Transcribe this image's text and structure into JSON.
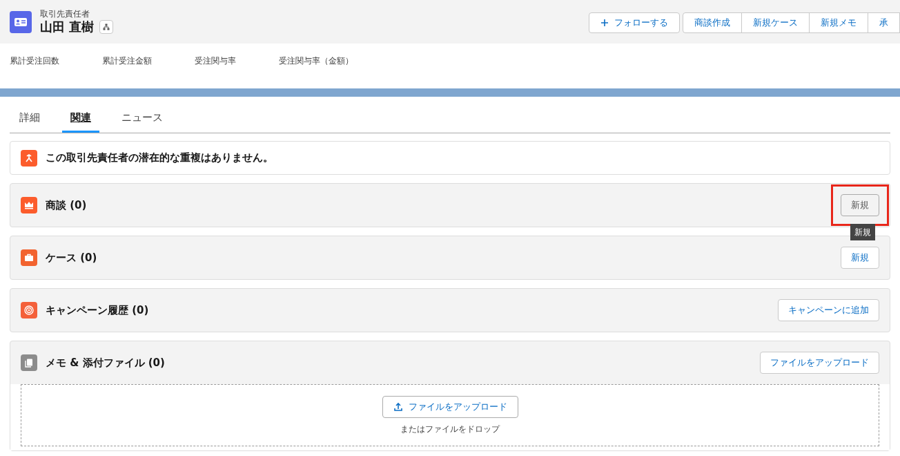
{
  "header": {
    "object_type": "取引先責任者",
    "name": "山田 直樹",
    "follow_button": "フォローする",
    "action_buttons": [
      "商談作成",
      "新規ケース",
      "新規メモ",
      "承"
    ]
  },
  "fields": [
    "累計受注回数",
    "累計受注金額",
    "受注関与率",
    "受注関与率（金額）"
  ],
  "tabs": [
    {
      "label": "詳細",
      "selected": false
    },
    {
      "label": "関連",
      "selected": true
    },
    {
      "label": "ニュース",
      "selected": false
    }
  ],
  "duplicate_notice": "この取引先責任者の潜在的な重複はありません。",
  "related_lists": [
    {
      "kind": "opportunity",
      "title": "商談 (0)",
      "button": {
        "label": "新規",
        "hovered": true,
        "highlighted": true,
        "tooltip": "新規"
      }
    },
    {
      "kind": "case",
      "title": "ケース (0)",
      "button": {
        "label": "新規",
        "hovered": false,
        "highlighted": false
      }
    },
    {
      "kind": "campaign",
      "title": "キャンペーン履歴 (0)",
      "button": {
        "label": "キャンペーンに追加",
        "hovered": false,
        "highlighted": false
      }
    },
    {
      "kind": "notes",
      "title": "メモ & 添付ファイル (0)",
      "button": {
        "label": "ファイルをアップロード",
        "hovered": false,
        "highlighted": false
      },
      "upload": {
        "button": "ファイルをアップロード",
        "hint": "またはファイルをドロップ"
      }
    }
  ]
}
